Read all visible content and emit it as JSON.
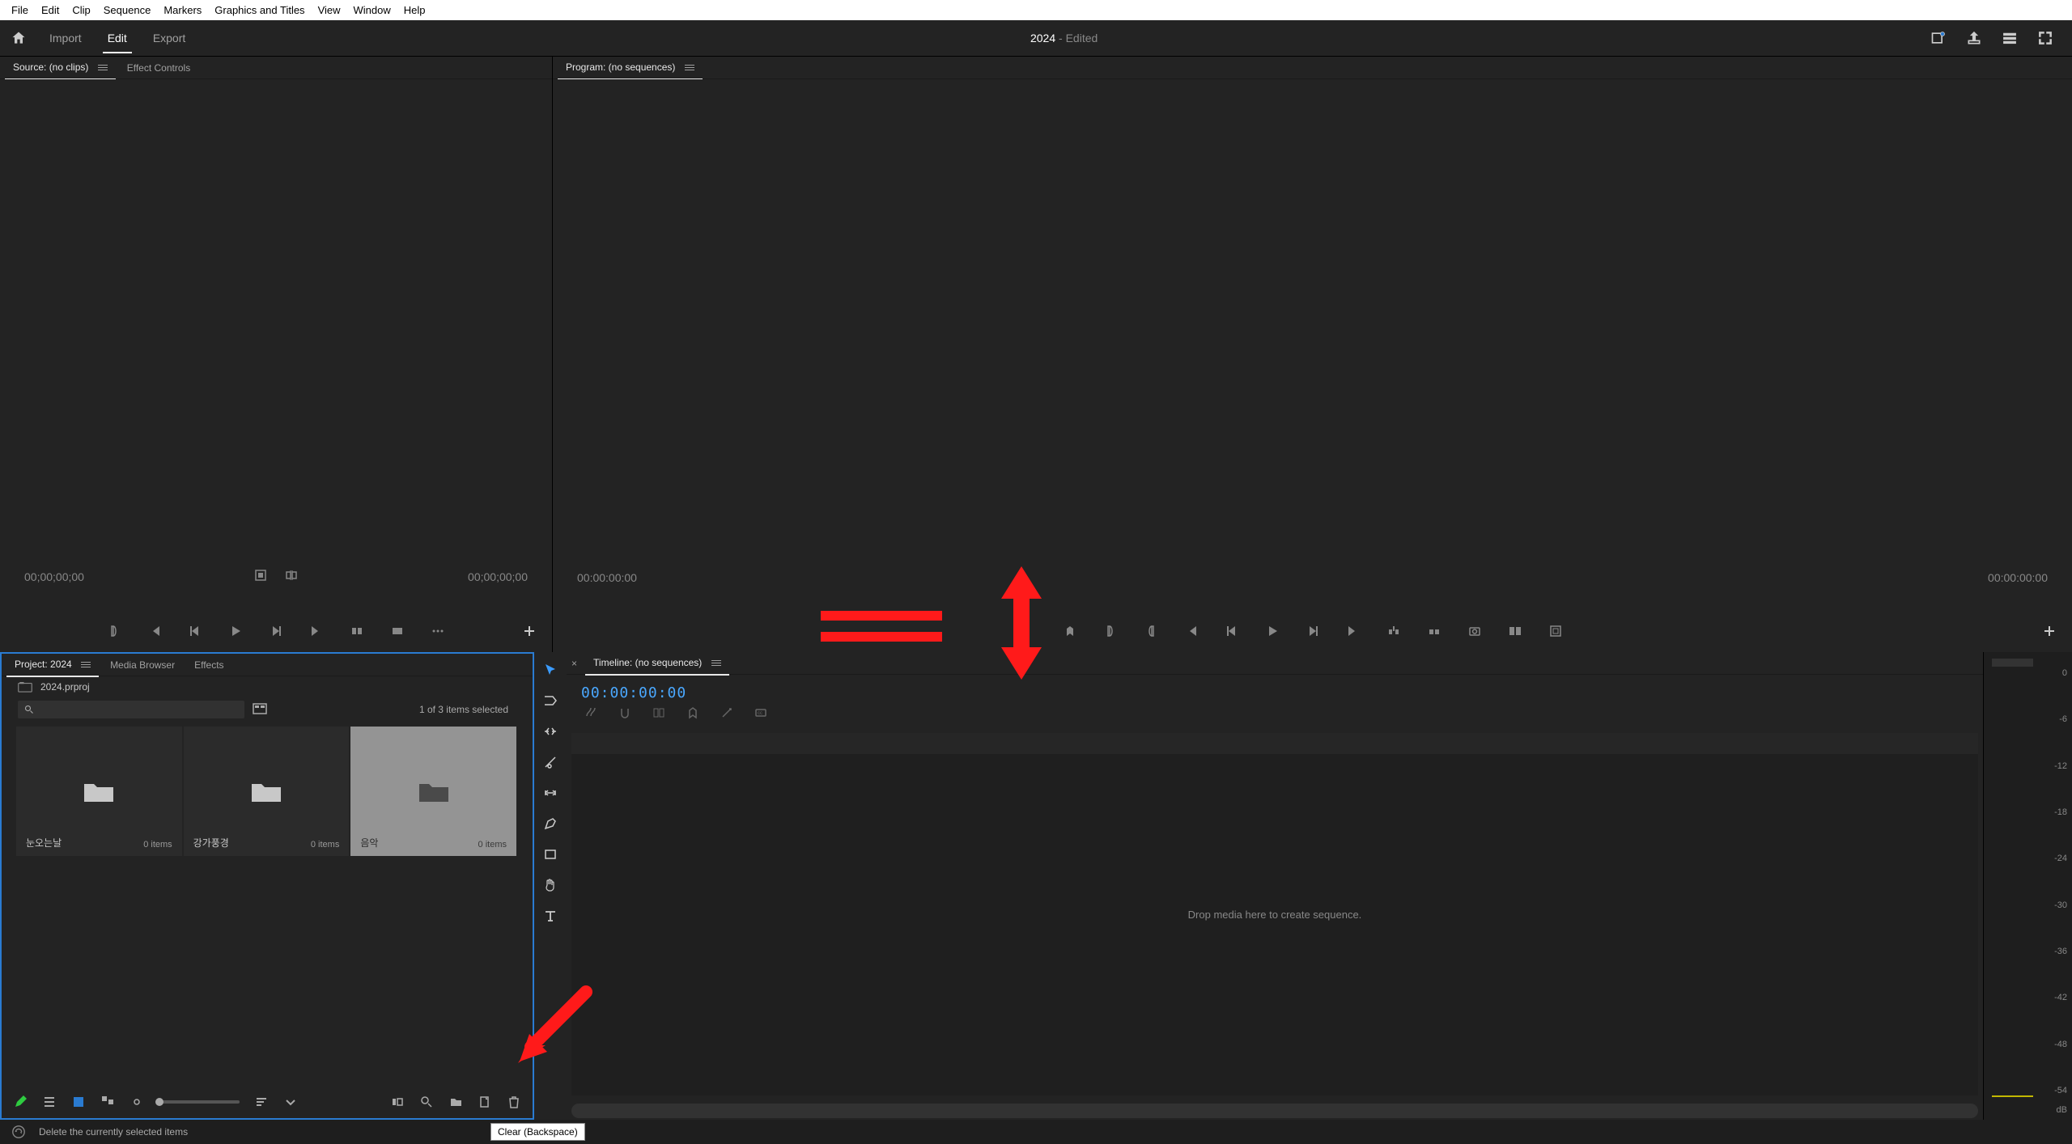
{
  "menubar": {
    "items": [
      "File",
      "Edit",
      "Clip",
      "Sequence",
      "Markers",
      "Graphics and Titles",
      "View",
      "Window",
      "Help"
    ]
  },
  "workspace_tabs": {
    "home_icon": "home",
    "tabs": [
      {
        "label": "Import"
      },
      {
        "label": "Edit",
        "active": true
      },
      {
        "label": "Export"
      }
    ]
  },
  "title": {
    "name": "2024",
    "suffix": " - Edited"
  },
  "header_icons": [
    "quick-export-icon",
    "share-icon",
    "workspaces-icon",
    "fullscreen-icon"
  ],
  "source_panel": {
    "tabs": [
      {
        "label": "Source: (no clips)",
        "active": true
      },
      {
        "label": "Effect Controls"
      }
    ],
    "tc_left": "00;00;00;00",
    "tc_right": "00;00;00;00"
  },
  "program_panel": {
    "tab_label": "Program: (no sequences)",
    "tc_left": "00:00:00:00",
    "tc_right": "00:00:00:00"
  },
  "project_panel": {
    "tabs": [
      {
        "label": "Project: 2024",
        "active": true
      },
      {
        "label": "Media Browser"
      },
      {
        "label": "Effects"
      }
    ],
    "file_name": "2024.prproj",
    "selection_info": "1 of 3 items selected",
    "bins": [
      {
        "name": "눈오는날",
        "count": "0 items",
        "selected": false
      },
      {
        "name": "강가풍경",
        "count": "0 items",
        "selected": false
      },
      {
        "name": "음악",
        "count": "0 items",
        "selected": true
      }
    ],
    "tooltip": "Clear (Backspace)"
  },
  "tool_column": [
    "selection-tool",
    "track-select-tool",
    "ripple-edit-tool",
    "razor-tool",
    "slip-tool",
    "pen-tool",
    "rectangle-tool",
    "hand-tool",
    "type-tool"
  ],
  "timeline_panel": {
    "tab_label": "Timeline: (no sequences)",
    "tc": "00:00:00:00",
    "drop_hint": "Drop media here to create sequence."
  },
  "audio_meter": {
    "ticks": [
      "0",
      "-6",
      "-12",
      "-18",
      "-24",
      "-30",
      "-36",
      "-42",
      "-48",
      "-54"
    ],
    "unit": "dB"
  },
  "statusbar": {
    "text": "Delete the currently selected items"
  }
}
